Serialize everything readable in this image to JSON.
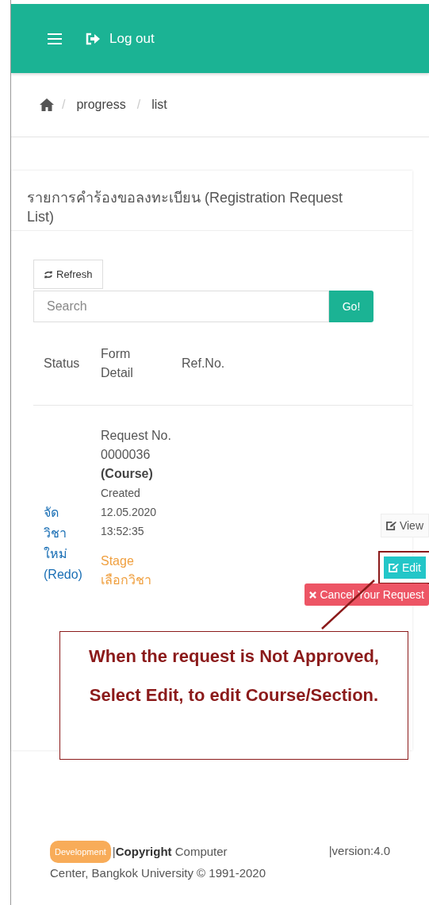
{
  "header": {
    "logout": "Log out"
  },
  "breadcrumb": {
    "separator": "/",
    "items": [
      "progress",
      "list"
    ]
  },
  "card": {
    "title": "รายการคำร้องขอลงทะเบียน (Registration Request List)",
    "refresh": "Refresh",
    "search": {
      "placeholder": "Search",
      "button": "Go!"
    },
    "columns": [
      "Status",
      "Form Detail",
      "Ref.No."
    ],
    "rows": [
      {
        "status": "จัดวิชาใหม่ (Redo)",
        "request": "Request No. 0000036",
        "type": "(Course)",
        "created": "Created 12.05.2020 13:52:35",
        "stage": "Stage เลือกวิชา",
        "actions": [
          {
            "kind": "view",
            "label": "View",
            "highlighted": false
          },
          {
            "kind": "edit",
            "label": "Edit",
            "highlighted": true
          },
          {
            "kind": "cancel",
            "label": "Cancel Your Request",
            "highlighted": false
          }
        ]
      }
    ]
  },
  "callout": "When the request is Not Approved, Select Edit, to edit Course/Section.",
  "footer": {
    "badge": "Development",
    "lines": [
      "|**Copyright** Computer",
      "Center, Bangkok University © 1991-2020"
    ],
    "version": "|version:4.0"
  }
}
